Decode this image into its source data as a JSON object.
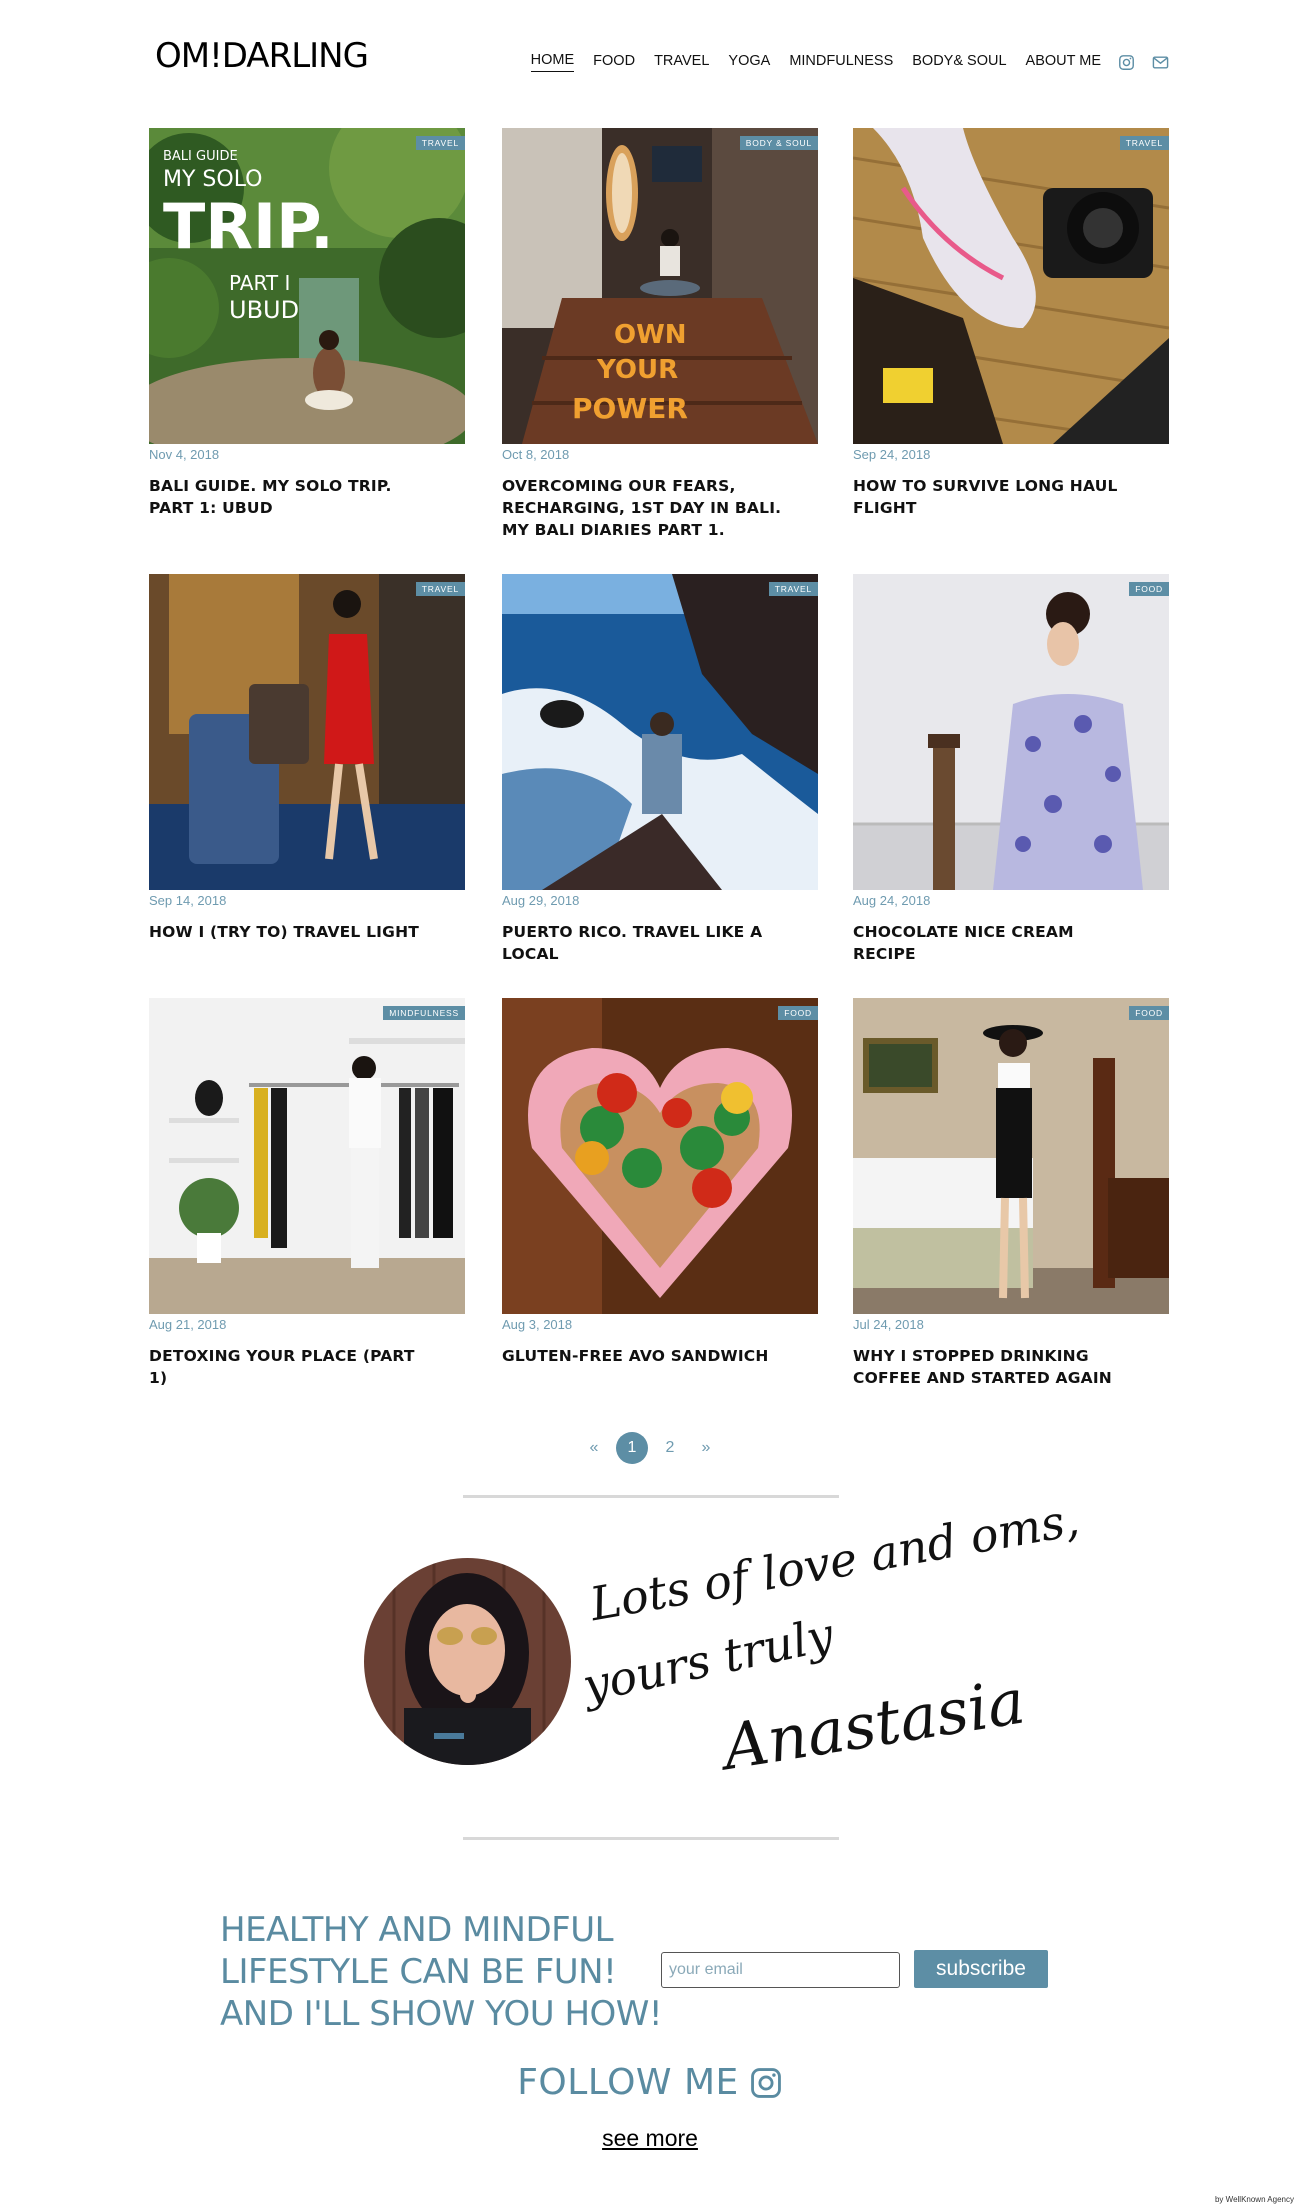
{
  "brand": {
    "logo": "OM!DARLING"
  },
  "nav": {
    "items": [
      "HOME",
      "FOOD",
      "TRAVEL",
      "YOGA",
      "MINDFULNESS",
      "BODY& SOUL",
      "ABOUT ME"
    ],
    "active": "HOME",
    "icons": [
      "instagram-icon",
      "mail-icon"
    ],
    "accent": "#5d8ea5"
  },
  "posts": [
    {
      "tag": "TRAVEL",
      "date": "Nov 4, 2018",
      "title": "BALI GUIDE. MY SOLO TRIP. PART 1: UBUD",
      "overlay_text": [
        "BALI GUIDE",
        "MY SOLO",
        "TRIP.",
        "PART I",
        "UBUD"
      ]
    },
    {
      "tag": "BODY & SOUL",
      "date": "Oct 8, 2018",
      "title": "OVERCOMING OUR FEARS, RECHARGING, 1ST DAY IN BALI. MY BALI DIARIES PART 1.",
      "overlay_text": [
        "OWN",
        "YOUR",
        "POWER"
      ]
    },
    {
      "tag": "TRAVEL",
      "date": "Sep 24, 2018",
      "title": "HOW TO SURVIVE LONG HAUL FLIGHT"
    },
    {
      "tag": "TRAVEL",
      "date": "Sep 14, 2018",
      "title": "HOW I (TRY TO) TRAVEL LIGHT"
    },
    {
      "tag": "TRAVEL",
      "date": "Aug 29, 2018",
      "title": "PUERTO RICO. TRAVEL LIKE A LOCAL"
    },
    {
      "tag": "FOOD",
      "date": "Aug 24, 2018",
      "title": "CHOCOLATE NICE CREAM RECIPE"
    },
    {
      "tag": "MINDFULNESS",
      "date": "Aug 21, 2018",
      "title": "DETOXING YOUR PLACE (PART 1)"
    },
    {
      "tag": "FOOD",
      "date": "Aug 3, 2018",
      "title": "GLUTEN-FREE AVO SANDWICH"
    },
    {
      "tag": "FOOD",
      "date": "Jul 24, 2018",
      "title": "WHY I STOPPED DRINKING COFFEE AND STARTED AGAIN"
    }
  ],
  "pagination": {
    "prev": "«",
    "pages": [
      "1",
      "2"
    ],
    "current": "1",
    "next": "»"
  },
  "signature": {
    "line1": "Lots of love and oms,",
    "line2": "yours truly",
    "name": "Anastasia"
  },
  "newsletter": {
    "tagline": "HEALTHY AND MINDFUL LIFESTYLE CAN BE FUN! AND I'LL SHOW YOU HOW!",
    "email_placeholder": "your email",
    "subscribe_label": "subscribe"
  },
  "follow": {
    "label": "FOLLOW ME",
    "icon": "instagram-icon",
    "see_more": "see more"
  },
  "credit": "by WellKnown Agency"
}
